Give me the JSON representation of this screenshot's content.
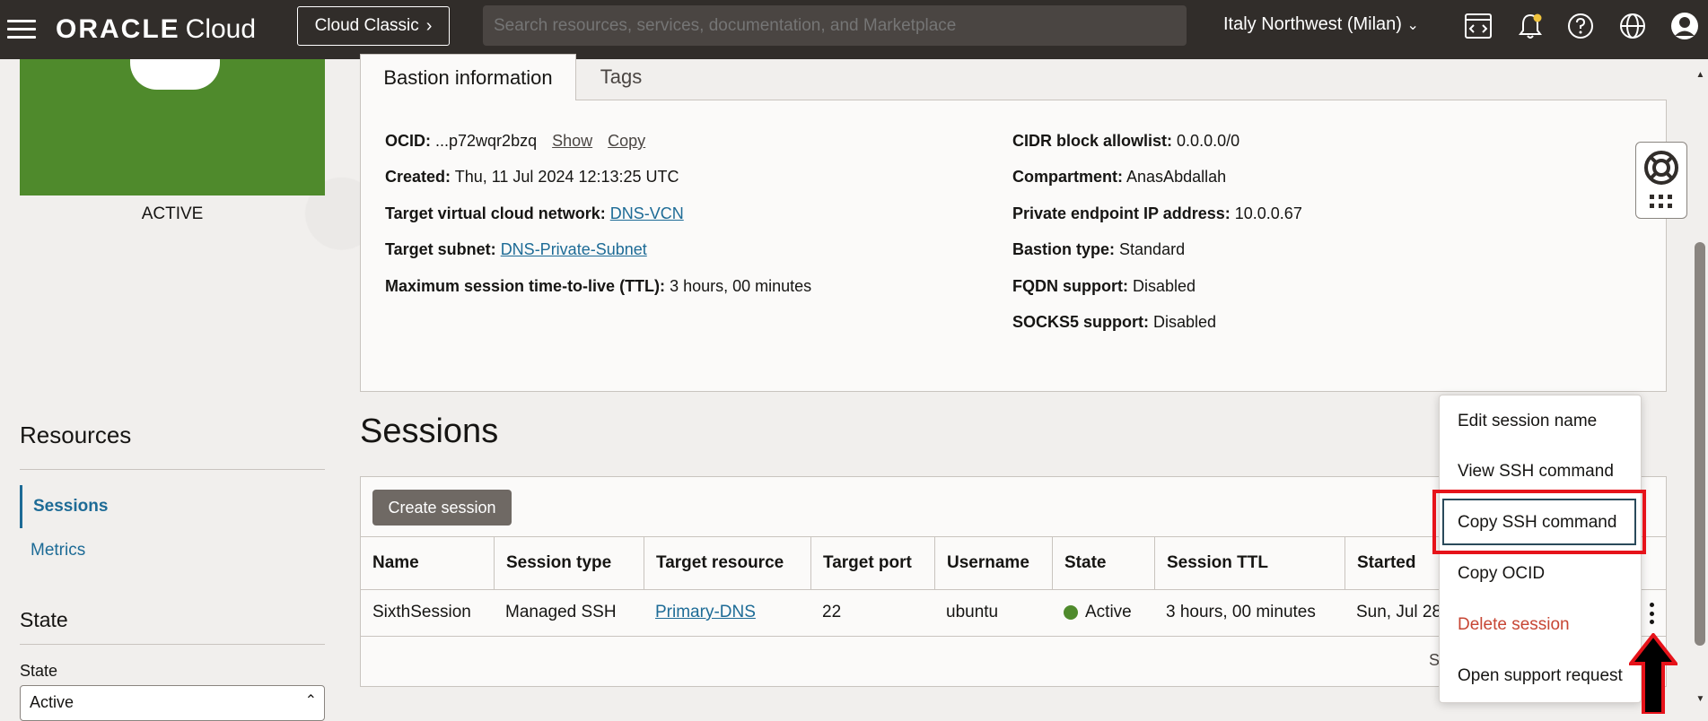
{
  "header": {
    "logo_oracle": "ORACLE",
    "logo_cloud": "Cloud",
    "classic_button": "Cloud Classic",
    "search_placeholder": "Search resources, services, documentation, and Marketplace",
    "region": "Italy Northwest (Milan)",
    "icons": [
      "menu-icon",
      "code-editor-icon",
      "bell-icon",
      "help-icon",
      "globe-icon",
      "user-icon"
    ]
  },
  "left": {
    "status": "ACTIVE",
    "resources_title": "Resources",
    "nav": [
      {
        "label": "Sessions",
        "active": true
      },
      {
        "label": "Metrics",
        "active": false
      }
    ],
    "state_title": "State",
    "state_label": "State",
    "state_value": "Active"
  },
  "tabs": [
    "Bastion information",
    "Tags"
  ],
  "info": {
    "ocid_label": "OCID:",
    "ocid_value": "...p72wqr2bzq",
    "ocid_show": "Show",
    "ocid_copy": "Copy",
    "created_label": "Created:",
    "created_value": "Thu, 11 Jul 2024 12:13:25 UTC",
    "vcn_label": "Target virtual cloud network:",
    "vcn_value": "DNS-VCN",
    "subnet_label": "Target subnet:",
    "subnet_value": "DNS-Private-Subnet",
    "ttl_label": "Maximum session time-to-live (TTL):",
    "ttl_value": "3 hours, 00 minutes",
    "cidr_label": "CIDR block allowlist:",
    "cidr_value": "0.0.0.0/0",
    "compartment_label": "Compartment:",
    "compartment_value": "AnasAbdallah",
    "private_ip_label": "Private endpoint IP address:",
    "private_ip_value": "10.0.0.67",
    "type_label": "Bastion type:",
    "type_value": "Standard",
    "fqdn_label": "FQDN support:",
    "fqdn_value": "Disabled",
    "socks_label": "SOCKS5 support:",
    "socks_value": "Disabled"
  },
  "sessions": {
    "title": "Sessions",
    "create_button": "Create session",
    "columns": [
      "Name",
      "Session type",
      "Target resource",
      "Target port",
      "Username",
      "State",
      "Session TTL",
      "Started"
    ],
    "row": {
      "name": "SixthSession",
      "type": "Managed SSH",
      "target": "Primary-DNS",
      "port": "22",
      "username": "ubuntu",
      "state": "Active",
      "ttl": "3 hours, 00 minutes",
      "started": "Sun, Jul 28"
    },
    "footer_partial": "S"
  },
  "menu": {
    "items": [
      {
        "label": "Edit session name"
      },
      {
        "label": "View SSH command"
      },
      {
        "label": "Copy SSH command"
      },
      {
        "label": "Copy OCID"
      },
      {
        "label": "Delete session"
      },
      {
        "label": "Open support request"
      }
    ]
  },
  "colors": {
    "header_bg": "#312d2a",
    "link": "#1d6b96",
    "active_green": "#4f8a2c",
    "danger": "#c74634",
    "highlight_red": "#e6131a"
  }
}
